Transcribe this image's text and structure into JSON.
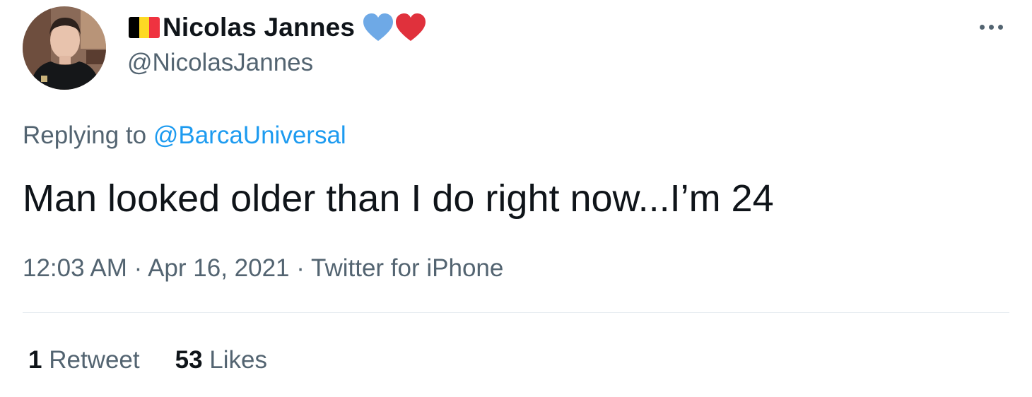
{
  "author": {
    "display_name": "Nicolas Jannes",
    "handle": "@NicolasJannes",
    "avatar_icon": "profile-photo",
    "flag_colors": [
      "#000000",
      "#fdda24",
      "#ef3340"
    ],
    "heart_colors": [
      "#6ea9e6",
      "#e0313c"
    ]
  },
  "more_icon": "ellipsis-icon",
  "reply": {
    "prefix": "Replying to",
    "mention": "@BarcaUniversal"
  },
  "tweet": {
    "text": "Man looked older than I do right now...I’m 24"
  },
  "meta": {
    "time": "12:03 AM",
    "date": "Apr 16, 2021",
    "source": "Twitter for iPhone",
    "separator": "·"
  },
  "stats": {
    "retweets_count": "1",
    "retweets_label": "Retweet",
    "likes_count": "53",
    "likes_label": "Likes"
  },
  "colors": {
    "text_primary": "#0f1419",
    "text_secondary": "#536471",
    "link": "#1d9bf0"
  }
}
